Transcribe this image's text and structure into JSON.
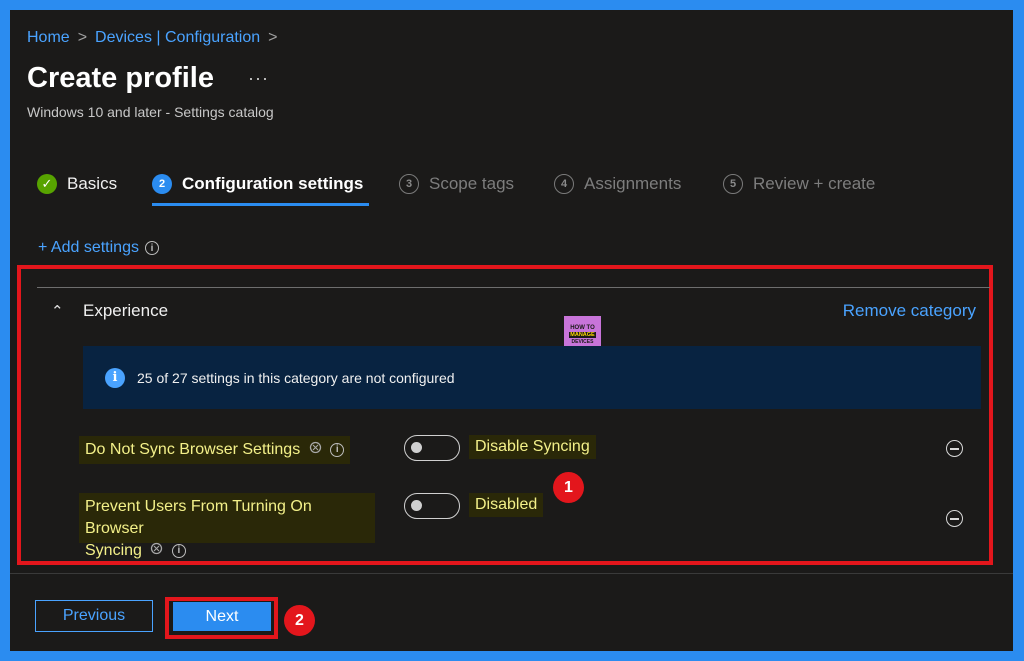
{
  "breadcrumb": {
    "items": [
      {
        "label": "Home"
      },
      {
        "label": "Devices | Configuration"
      }
    ],
    "separator": ">"
  },
  "header": {
    "title": "Create profile",
    "more_label": "···",
    "subtitle": "Windows 10 and later - Settings catalog"
  },
  "wizard": {
    "steps": [
      {
        "number": "✓",
        "label": "Basics",
        "state": "done"
      },
      {
        "number": "2",
        "label": "Configuration settings",
        "state": "active"
      },
      {
        "number": "3",
        "label": "Scope tags",
        "state": "inactive"
      },
      {
        "number": "4",
        "label": "Assignments",
        "state": "inactive"
      },
      {
        "number": "5",
        "label": "Review + create",
        "state": "inactive"
      }
    ]
  },
  "add_settings": {
    "label": "+ Add settings",
    "info_glyph": "i"
  },
  "category": {
    "chevron": "⌃",
    "title": "Experience",
    "remove_label": "Remove category",
    "logo": {
      "line1": "HOW TO",
      "line2": "MANAGE",
      "line3": "DEVICES"
    },
    "banner": {
      "icon_glyph": "i",
      "text": "25 of 27 settings in this category are not configured"
    },
    "settings": [
      {
        "name": "Do Not Sync Browser Settings",
        "value": "Disable Syncing",
        "enabled": false
      },
      {
        "name_line1": "Prevent Users From Turning On Browser",
        "name_line2": "Syncing",
        "value": "Disabled",
        "enabled": false
      }
    ]
  },
  "annotations": {
    "badge1": "1",
    "badge2": "2"
  },
  "footer": {
    "previous_label": "Previous",
    "next_label": "Next"
  },
  "colors": {
    "accent": "#2b8cf0",
    "link": "#4aa3ff",
    "highlight_red": "#e3161c",
    "success": "#57a300",
    "background": "#1b1a19"
  }
}
